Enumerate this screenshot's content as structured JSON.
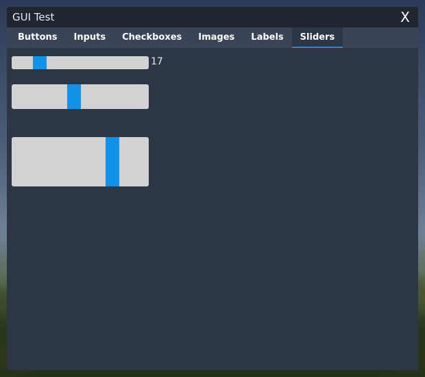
{
  "window": {
    "title": "GUI Test",
    "close_label": "X"
  },
  "tabs": [
    {
      "label": "Buttons",
      "active": false
    },
    {
      "label": "Inputs",
      "active": false
    },
    {
      "label": "Checkboxes",
      "active": false
    },
    {
      "label": "Images",
      "active": false
    },
    {
      "label": "Labels",
      "active": false
    },
    {
      "label": "Sliders",
      "active": true
    }
  ],
  "sliders": [
    {
      "value_fraction": 0.17,
      "value_label": "17"
    },
    {
      "value_fraction": 0.45
    },
    {
      "value_fraction": 0.76
    }
  ],
  "colors": {
    "accent": "#1192ea",
    "track": "#d2d2d2",
    "panel": "#2d3645"
  }
}
